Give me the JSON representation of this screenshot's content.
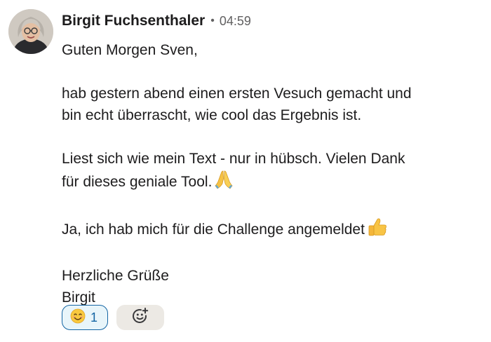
{
  "message": {
    "author": "Birgit Fuchsenthaler",
    "separator": "•",
    "time": "04:59",
    "avatar_icon": "profile-photo",
    "lines": {
      "greeting": "Guten Morgen Sven,",
      "p1_l1": "hab gestern abend einen ersten Vesuch gemacht und",
      "p1_l2": "bin echt überrascht, wie cool das Ergebnis ist.",
      "p2_l1": "Liest sich wie mein Text - nur in hübsch. Vielen Dank",
      "p2_l2": "für dieses geniale Tool.",
      "p3_l1": "Ja, ich hab mich für die Challenge angemeldet",
      "closing": "Herzliche Grüße",
      "signature": "Birgit"
    },
    "inline_emojis": [
      "folded-hands-emoji",
      "thumbs-up-emoji"
    ]
  },
  "reactions": [
    {
      "emoji": "smiling-face-emoji",
      "count": "1",
      "active": true
    }
  ],
  "add_reaction": {
    "icon": "add-reaction-icon"
  },
  "colors": {
    "text": "#1d1c1d",
    "muted": "#616061",
    "reaction_border": "#1264a3",
    "reaction_bg": "#e8f5fa",
    "add_bg": "#ece9e4"
  }
}
